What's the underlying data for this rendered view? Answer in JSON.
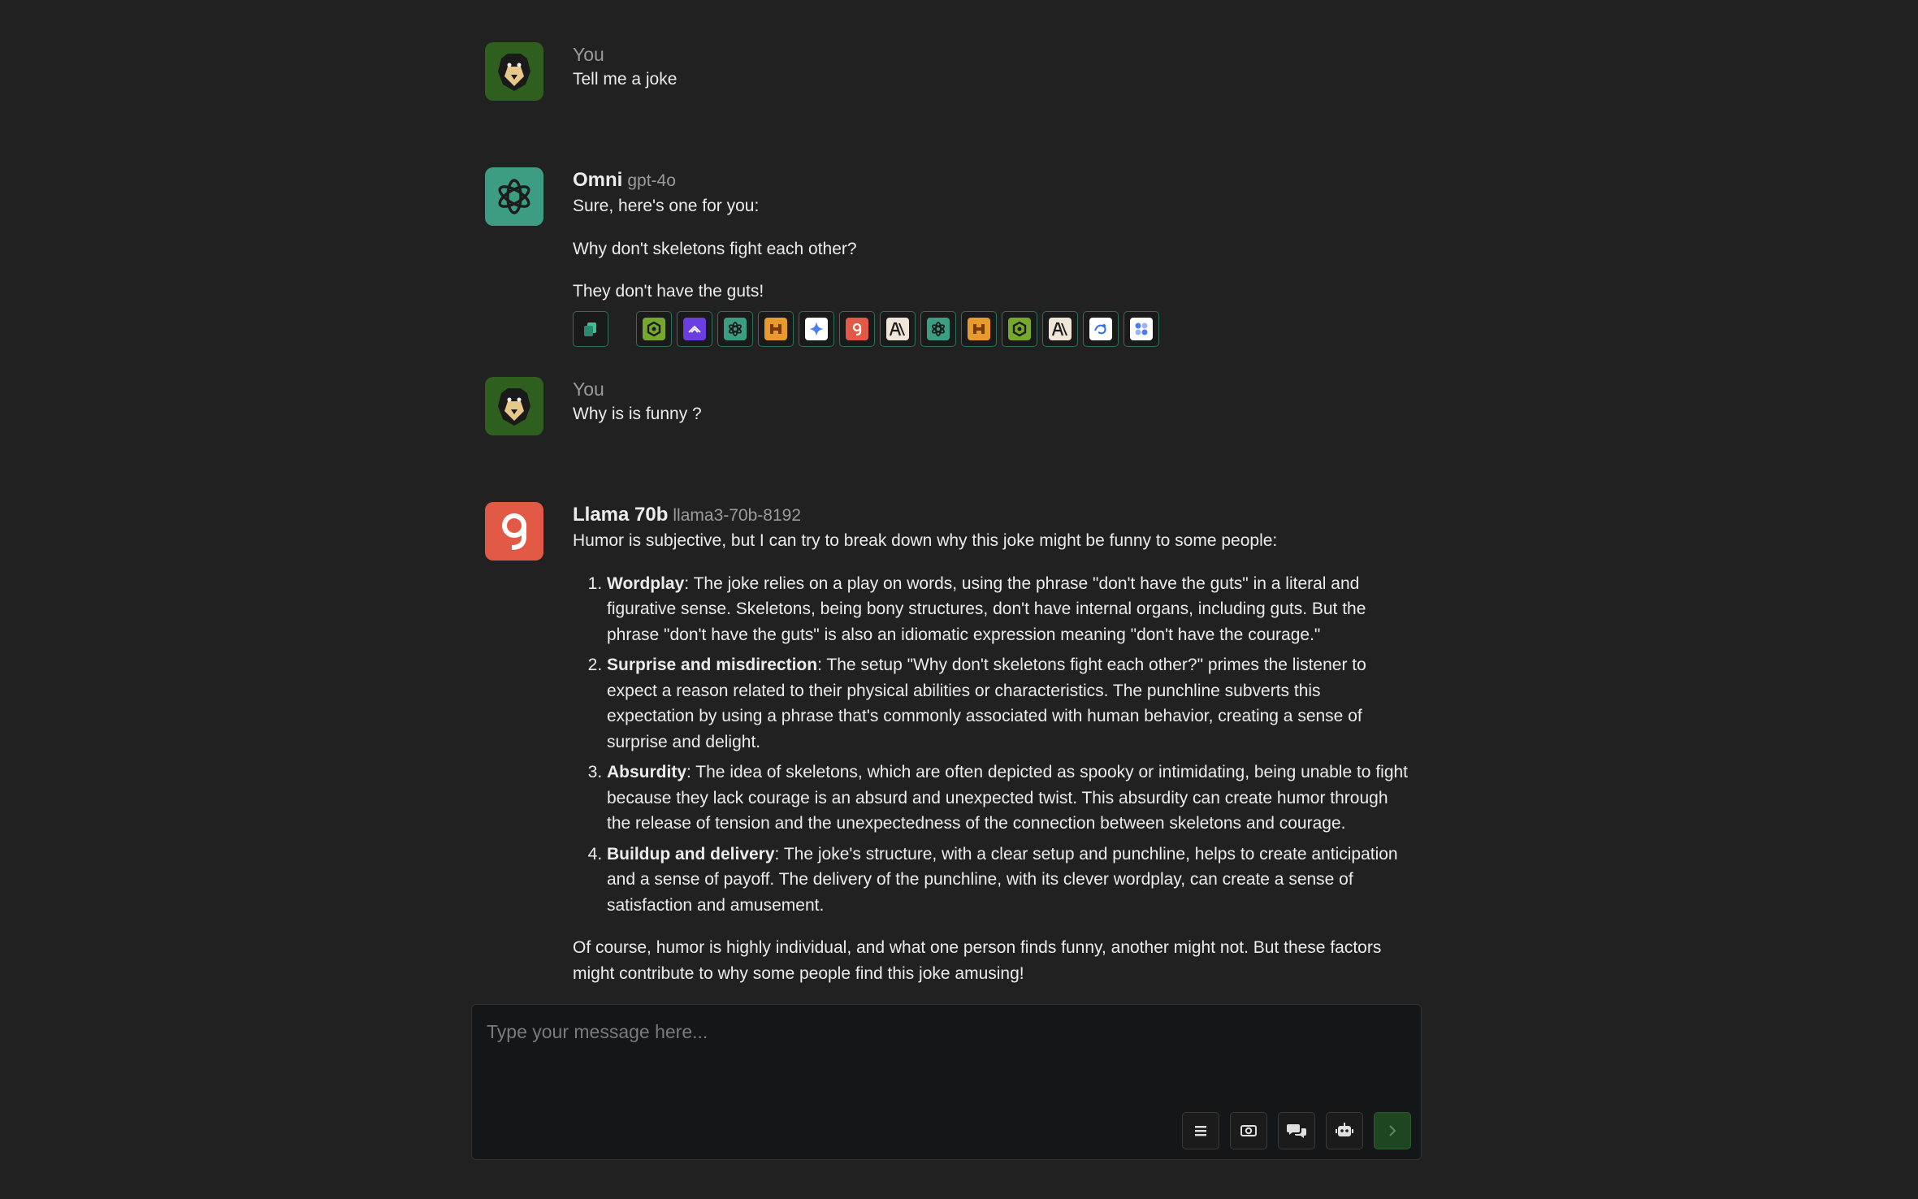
{
  "conversation": [
    {
      "role": "user",
      "sender": "You",
      "text": "Tell me a joke"
    },
    {
      "role": "assistant",
      "name": "Omni",
      "model": "gpt-4o",
      "paragraphs": [
        "Sure, here's one for you:",
        "Why don't skeletons fight each other?",
        "They don't have the guts!"
      ],
      "model_switcher_icons": [
        "perplexity-icon",
        "mistral-icon",
        "openai-icon",
        "mistral-icon",
        "gemini-icon",
        "groq-icon",
        "anthropic-icon",
        "openai-icon",
        "mistral-icon",
        "perplexity-icon",
        "anthropic-icon",
        "custom-icon",
        "more-models-icon"
      ]
    },
    {
      "role": "user",
      "sender": "You",
      "text": "Why is is funny ?"
    },
    {
      "role": "assistant",
      "name": "Llama 70b",
      "model": "llama3-70b-8192",
      "intro": "Humor is subjective, but I can try to break down why this joke might be funny to some people:",
      "points": [
        {
          "title": "Wordplay",
          "text": ": The joke relies on a play on words, using the phrase \"don't have the guts\" in a literal and figurative sense. Skeletons, being bony structures, don't have internal organs, including guts. But the phrase \"don't have the guts\" is also an idiomatic expression meaning \"don't have the courage.\""
        },
        {
          "title": "Surprise and misdirection",
          "text": ": The setup \"Why don't skeletons fight each other?\" primes the listener to expect a reason related to their physical abilities or characteristics. The punchline subverts this expectation by using a phrase that's commonly associated with human behavior, creating a sense of surprise and delight."
        },
        {
          "title": "Absurdity",
          "text": ": The idea of skeletons, which are often depicted as spooky or intimidating, being unable to fight because they lack courage is an absurd and unexpected twist. This absurdity can create humor through the release of tension and the unexpectedness of the connection between skeletons and courage."
        },
        {
          "title": "Buildup and delivery",
          "text": ": The joke's structure, with a clear setup and punchline, helps to create anticipation and a sense of payoff. The delivery of the punchline, with its clever wordplay, can create a sense of satisfaction and amusement."
        }
      ],
      "outro": "Of course, humor is highly individual, and what one person finds funny, another might not. But these factors might contribute to why some people find this joke amusing!"
    }
  ],
  "composer": {
    "placeholder": "Type your message here...",
    "value": ""
  },
  "colors": {
    "background": "#212121",
    "accent_teal": "#3c9d82",
    "llama_red": "#e25a45",
    "send_green": "#1e4620"
  }
}
